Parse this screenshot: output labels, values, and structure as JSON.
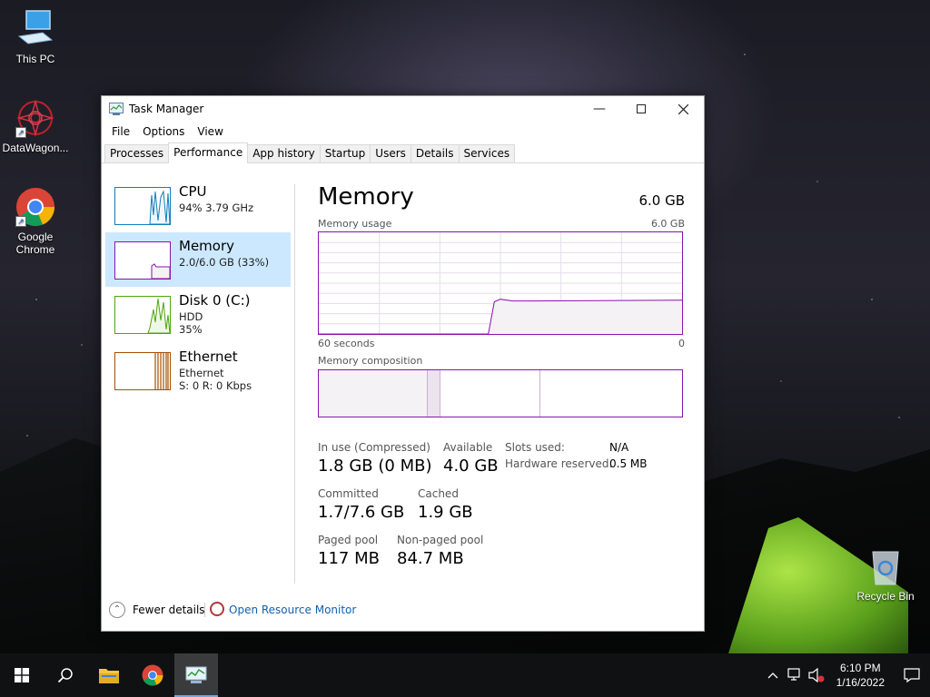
{
  "desktop": {
    "icons": [
      {
        "label": "This PC"
      },
      {
        "label": "DataWagon..."
      },
      {
        "label": "Google Chrome"
      },
      {
        "label": "Recycle Bin"
      }
    ]
  },
  "window": {
    "title": "Task Manager",
    "menu": [
      "File",
      "Options",
      "View"
    ],
    "tabs": [
      "Processes",
      "Performance",
      "App history",
      "Startup",
      "Users",
      "Details",
      "Services"
    ],
    "active_tab": "Performance"
  },
  "sidebar": {
    "items": [
      {
        "name": "CPU",
        "sub1": "94% 3.79 GHz",
        "sub2": "",
        "color": "#117dbb"
      },
      {
        "name": "Memory",
        "sub1": "2.0/6.0 GB (33%)",
        "sub2": "",
        "color": "#8b12ae",
        "active": true
      },
      {
        "name": "Disk 0 (C:)",
        "sub1": "HDD",
        "sub2": "35%",
        "color": "#4da60c"
      },
      {
        "name": "Ethernet",
        "sub1": "Ethernet",
        "sub2": "S: 0 R: 0 Kbps",
        "color": "#a74f01"
      }
    ]
  },
  "memory": {
    "title": "Memory",
    "total": "6.0 GB",
    "usage_label": "Memory usage",
    "usage_max": "6.0 GB",
    "time_left": "60 seconds",
    "time_right": "0",
    "composition_label": "Memory composition",
    "composition": {
      "in_use_fraction": 0.3,
      "modified_fraction": 0.035,
      "standby_fraction": 0.275
    },
    "usage_history": {
      "x_seconds_ago": [
        60,
        32,
        31,
        30,
        28,
        25,
        0
      ],
      "used_gb": [
        0,
        0,
        1.9,
        2.05,
        1.95,
        1.95,
        2.0
      ]
    },
    "stats": {
      "in_use_label": "In use (Compressed)",
      "in_use_value": "1.8 GB (0 MB)",
      "available_label": "Available",
      "available_value": "4.0 GB",
      "committed_label": "Committed",
      "committed_value": "1.7/7.6 GB",
      "cached_label": "Cached",
      "cached_value": "1.9 GB",
      "paged_label": "Paged pool",
      "paged_value": "117 MB",
      "nonpaged_label": "Non-paged pool",
      "nonpaged_value": "84.7 MB",
      "slots_label": "Slots used:",
      "slots_value": "N/A",
      "hw_label": "Hardware reserved:",
      "hw_value": "0.5 MB"
    }
  },
  "footer": {
    "fewer_details": "Fewer details",
    "open_resource_monitor": "Open Resource Monitor"
  },
  "taskbar": {
    "time": "6:10 PM",
    "date": "1/16/2022"
  },
  "colors": {
    "memory_accent": "#8b12ae",
    "selected_bg": "#cce8ff"
  }
}
